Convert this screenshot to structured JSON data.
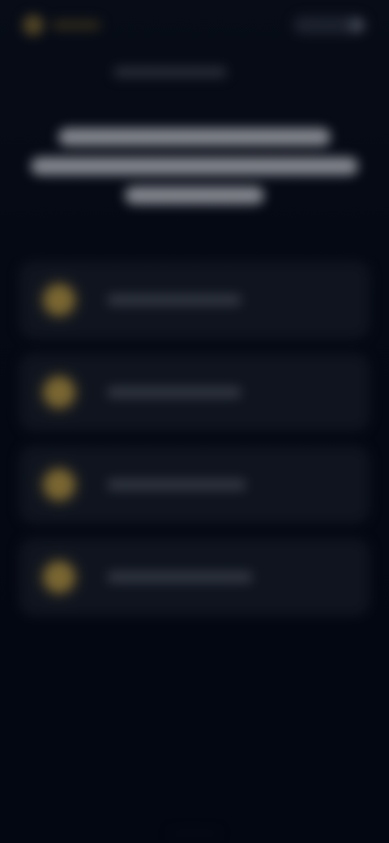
{
  "screen": {
    "state": "blurred",
    "colors": {
      "background_top": "#0a101c",
      "background_bottom": "#030813",
      "card": "#161c28",
      "accent": "#b99a44",
      "headline_text": "#c9ccd3",
      "muted_text": "#4b515d"
    }
  },
  "header": {
    "logo_icon": "brand-logo-icon",
    "brand_label": "",
    "action_label": ""
  },
  "hero": {
    "eyebrow": "",
    "headline_lines": [
      "",
      "",
      ""
    ]
  },
  "steps": [
    {
      "icon": "gold-circle-icon",
      "label": ""
    },
    {
      "icon": "gold-circle-icon",
      "label": ""
    },
    {
      "icon": "gold-circle-icon",
      "label": ""
    },
    {
      "icon": "gold-circle-icon",
      "label": ""
    }
  ]
}
